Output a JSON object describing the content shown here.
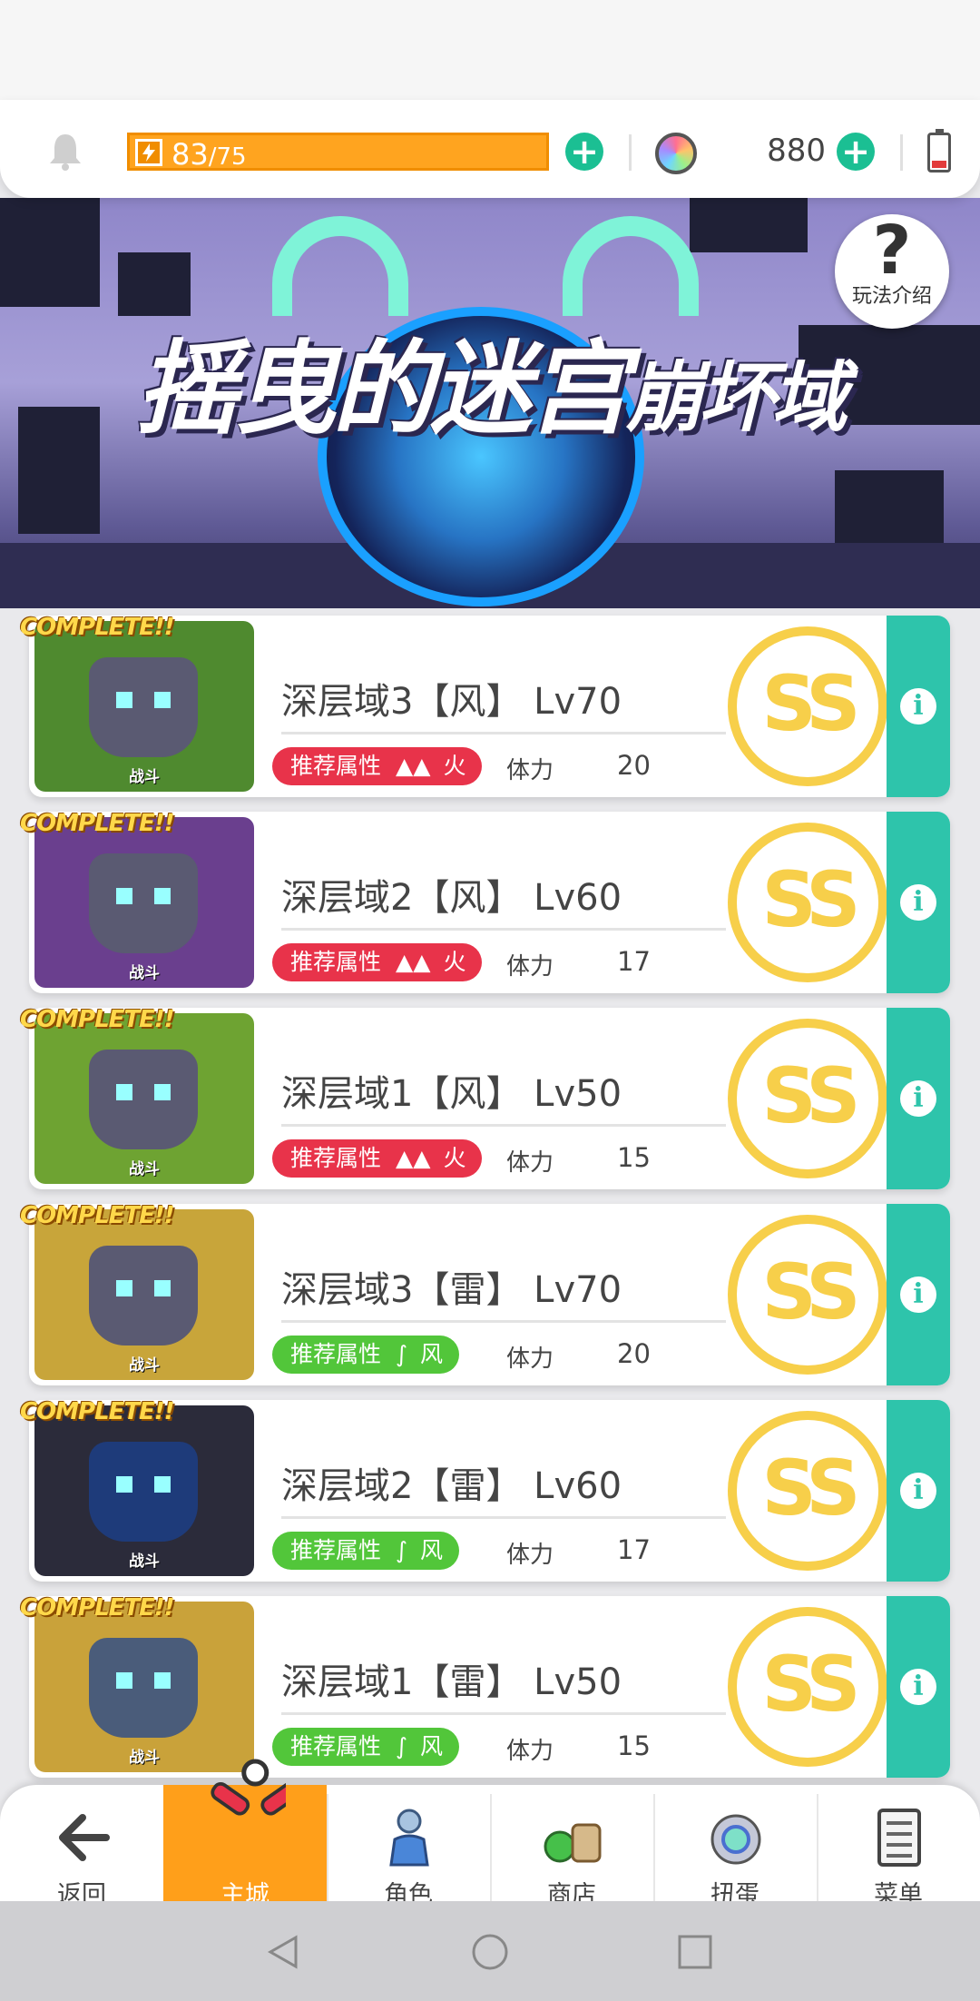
{
  "resources": {
    "energy_current": "83",
    "energy_max": "/75",
    "gems": "880"
  },
  "banner": {
    "title_main": "摇曳的迷宫",
    "title_sub": "崩坏域",
    "help_label": "玩法介绍"
  },
  "stages": [
    {
      "complete": "COMPLETE!!",
      "thumb_label": "战斗",
      "name": "深层域3【风】 Lv70",
      "attr_label": "推荐属性",
      "attr_value": "火",
      "attr_type": "fire",
      "stamina_label": "体力",
      "stamina": "20",
      "rank": "SS",
      "thumb_color": "#4f8a2f"
    },
    {
      "complete": "COMPLETE!!",
      "thumb_label": "战斗",
      "name": "深层域2【风】 Lv60",
      "attr_label": "推荐属性",
      "attr_value": "火",
      "attr_type": "fire",
      "stamina_label": "体力",
      "stamina": "17",
      "rank": "SS",
      "thumb_color": "#6a3f8e"
    },
    {
      "complete": "COMPLETE!!",
      "thumb_label": "战斗",
      "name": "深层域1【风】 Lv50",
      "attr_label": "推荐属性",
      "attr_value": "火",
      "attr_type": "fire",
      "stamina_label": "体力",
      "stamina": "15",
      "rank": "SS",
      "thumb_color": "#6ea332"
    },
    {
      "complete": "COMPLETE!!",
      "thumb_label": "战斗",
      "name": "深层域3【雷】 Lv70",
      "attr_label": "推荐属性",
      "attr_value": "风",
      "attr_type": "wind",
      "stamina_label": "体力",
      "stamina": "20",
      "rank": "SS",
      "thumb_color": "#c8a53a"
    },
    {
      "complete": "COMPLETE!!",
      "thumb_label": "战斗",
      "name": "深层域2【雷】 Lv60",
      "attr_label": "推荐属性",
      "attr_value": "风",
      "attr_type": "wind",
      "stamina_label": "体力",
      "stamina": "17",
      "rank": "SS",
      "thumb_color": "#2b2b3a"
    },
    {
      "complete": "COMPLETE!!",
      "thumb_label": "战斗",
      "name": "深层域1【雷】 Lv50",
      "attr_label": "推荐属性",
      "attr_value": "风",
      "attr_type": "wind",
      "stamina_label": "体力",
      "stamina": "15",
      "rank": "SS",
      "thumb_color": "#c9a23a"
    }
  ],
  "nav": {
    "back": "返回",
    "home": "主城",
    "character": "角色",
    "shop": "商店",
    "gacha": "扭蛋",
    "menu": "菜单"
  },
  "colors": {
    "accent_orange": "#ff9f1a",
    "teal": "#2ec4ab",
    "fire_red": "#e8334a",
    "wind_green": "#52c63a",
    "rank_gold": "#f7cf4a"
  }
}
